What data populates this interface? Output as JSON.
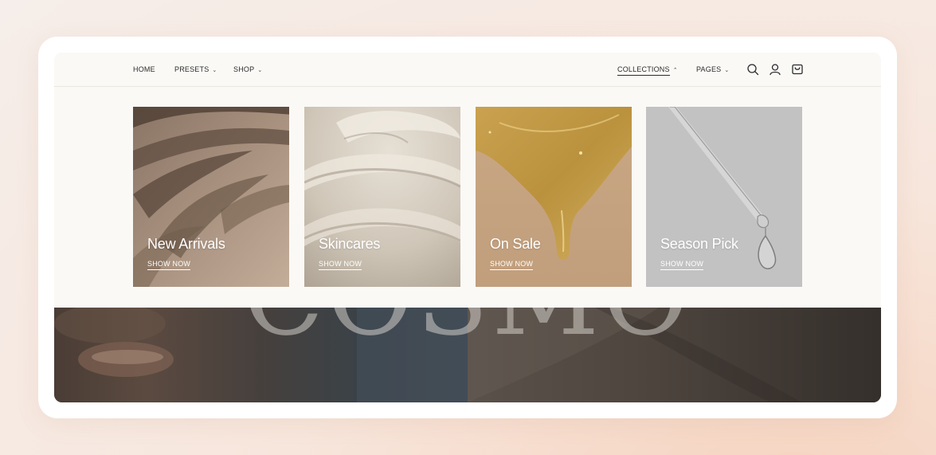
{
  "nav_left": [
    {
      "label": "HOME",
      "has_caret": false
    },
    {
      "label": "PRESETS",
      "has_caret": true
    },
    {
      "label": "SHOP",
      "has_caret": true
    }
  ],
  "nav_right": [
    {
      "label": "COLLECTIONS",
      "caret": "⌃",
      "active": true
    },
    {
      "label": "PAGES",
      "caret": "⌄",
      "active": false
    }
  ],
  "caret_down": "⌄",
  "icons": [
    "search-icon",
    "account-icon",
    "cart-icon"
  ],
  "collections": [
    {
      "title": "New Arrivals",
      "link": "SHOW NOW",
      "image": "palm-shadow-sand"
    },
    {
      "title": "Skincares",
      "link": "SHOW NOW",
      "image": "cream-swirl"
    },
    {
      "title": "On Sale",
      "link": "SHOW NOW",
      "image": "honey-serum-drip"
    },
    {
      "title": "Season Pick",
      "link": "SHOW NOW",
      "image": "dropper-pipette"
    }
  ],
  "hero": {
    "word": "COSMO"
  },
  "colors": {
    "accent": "#2b2b2b",
    "menu_bg": "#faf9f6"
  }
}
